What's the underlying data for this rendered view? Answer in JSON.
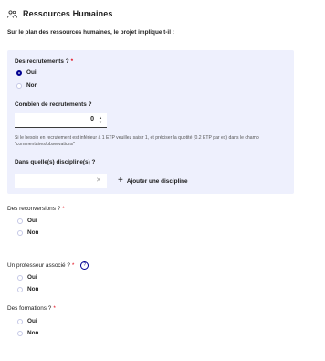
{
  "section": {
    "title": "Ressources Humaines",
    "icon": "people-icon"
  },
  "intro": "Sur le plan des ressources humaines, le projet implique t-il :",
  "recruitment": {
    "question": "Des recrutements ?",
    "required_mark": "*",
    "options": [
      {
        "label": "Oui",
        "checked": true
      },
      {
        "label": "Non",
        "checked": false
      }
    ],
    "count_label": "Combien de recrutements ?",
    "count_value": "0",
    "hint": "Si le besoin en recrutement est inférieur à 1 ETP veuillez saisir 1, et préciser la quotité (0.2 ETP par ex) dans le champ \"commentaires/observations\"",
    "discipline_label": "Dans quelle(s) discipline(s) ?",
    "discipline_value": "",
    "add_label": "Ajouter une discipline"
  },
  "reconversions": {
    "question": "Des reconversions ?",
    "required_mark": "*",
    "options": [
      {
        "label": "Oui",
        "checked": false
      },
      {
        "label": "Non",
        "checked": false
      }
    ]
  },
  "professor": {
    "question": "Un professeur associé ?",
    "required_mark": "*",
    "help_icon": "?",
    "options": [
      {
        "label": "Oui",
        "checked": false
      },
      {
        "label": "Non",
        "checked": false
      }
    ]
  },
  "trainings": {
    "question": "Des formations ?",
    "required_mark": "*",
    "options": [
      {
        "label": "Oui",
        "checked": false
      },
      {
        "label": "Non",
        "checked": false
      }
    ]
  },
  "colors": {
    "accent": "#000091",
    "panel": "#eef0fd",
    "required": "#e1000f"
  }
}
